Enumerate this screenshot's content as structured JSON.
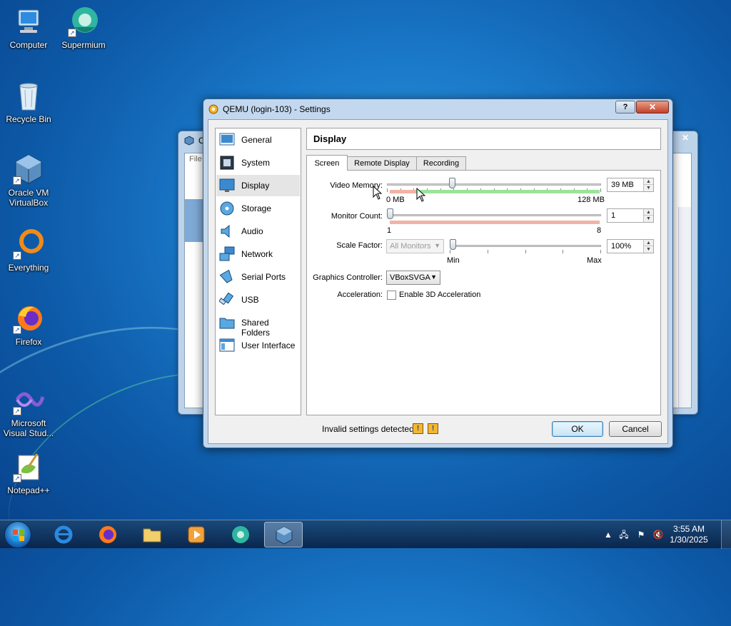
{
  "desktop": {
    "icons": [
      {
        "label": "Computer"
      },
      {
        "label": "Supermium"
      },
      {
        "label": "Recycle Bin"
      },
      {
        "label": "Oracle VM VirtualBox"
      },
      {
        "label": "Everything"
      },
      {
        "label": "Firefox"
      },
      {
        "label": "Microsoft Visual Stud..."
      },
      {
        "label": "Notepad++"
      }
    ]
  },
  "background_window": {
    "title_fragment": "O",
    "menu_fragment": "File"
  },
  "dialog": {
    "title": "QEMU (login-103) - Settings",
    "help_label": "?",
    "close_label": "✕",
    "sidebar": [
      {
        "label": "General",
        "icon": "general-icon"
      },
      {
        "label": "System",
        "icon": "system-icon"
      },
      {
        "label": "Display",
        "icon": "display-icon",
        "selected": true
      },
      {
        "label": "Storage",
        "icon": "storage-icon"
      },
      {
        "label": "Audio",
        "icon": "audio-icon"
      },
      {
        "label": "Network",
        "icon": "network-icon"
      },
      {
        "label": "Serial Ports",
        "icon": "serial-ports-icon"
      },
      {
        "label": "USB",
        "icon": "usb-icon"
      },
      {
        "label": "Shared Folders",
        "icon": "shared-folders-icon"
      },
      {
        "label": "User Interface",
        "icon": "user-interface-icon"
      }
    ],
    "page_title": "Display",
    "tabs": [
      {
        "label": "Screen",
        "active": true
      },
      {
        "label": "Remote Display"
      },
      {
        "label": "Recording"
      }
    ],
    "screen": {
      "video_memory": {
        "label": "Video Memory:",
        "value": "39 MB",
        "min_label": "0 MB",
        "max_label": "128 MB",
        "level": 0.3
      },
      "monitor_count": {
        "label": "Monitor Count:",
        "value": "1",
        "min_label": "1",
        "max_label": "8",
        "level": 0.0
      },
      "scale_factor": {
        "label": "Scale Factor:",
        "monitor_select": "All Monitors",
        "value": "100%",
        "min_label": "Min",
        "max_label": "Max",
        "level": 0.0
      },
      "graphics_controller": {
        "label": "Graphics Controller:",
        "value": "VBoxSVGA"
      },
      "acceleration": {
        "label": "Acceleration:",
        "checkbox_label": "Enable 3D Acceleration",
        "checked": false
      }
    },
    "footer": {
      "invalid_text": "Invalid settings detected",
      "ok_label": "OK",
      "cancel_label": "Cancel"
    }
  },
  "taskbar": {
    "apps": [
      "internet-explorer-icon",
      "firefox-icon",
      "file-explorer-icon",
      "media-player-icon",
      "supermium-icon",
      "virtualbox-icon"
    ],
    "active_app": "virtualbox-icon",
    "time": "3:55 AM",
    "date": "1/30/2025"
  },
  "colors": {
    "accent": "#3c7fb1",
    "memory_green": "#9be39b",
    "memory_red": "#f2b3a6"
  }
}
